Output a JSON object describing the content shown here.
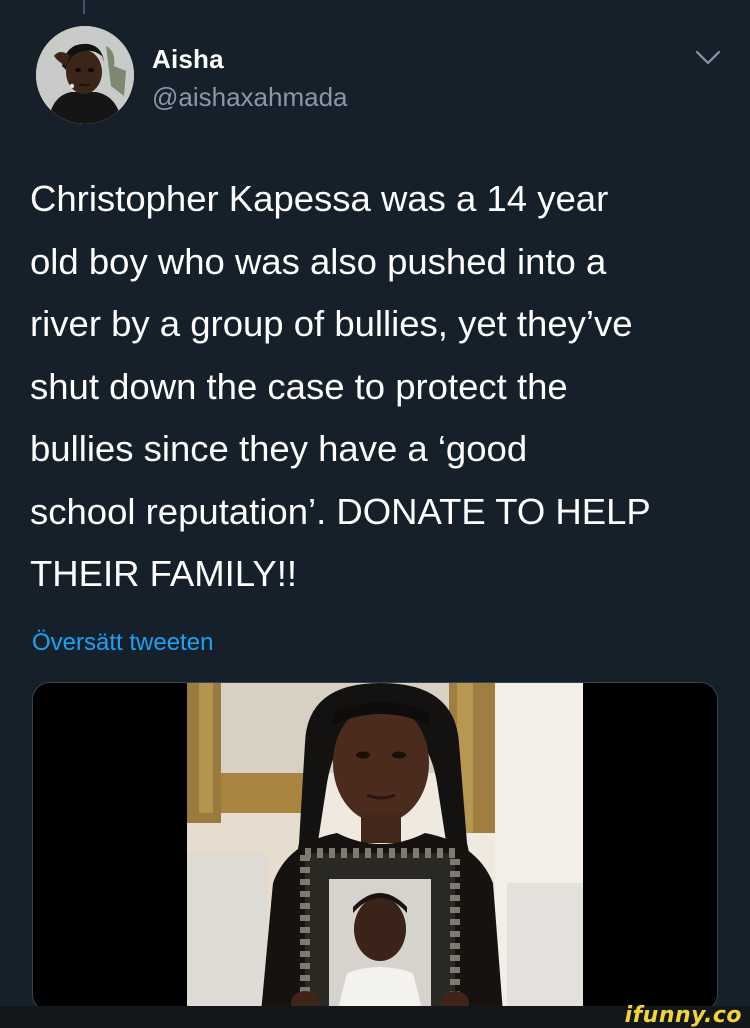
{
  "tweet": {
    "author_name": "Aisha",
    "author_handle": "@aishaxahmada",
    "text_lines": [
      "Christopher Kapessa was a 14 year",
      "old boy who was also pushed into a",
      "river by a group of bullies, yet they’ve",
      "shut down the case to protect the",
      "bullies since they have a ‘good",
      "school reputation’. DONATE TO HELP",
      "THEIR FAMILY!!"
    ],
    "translate_label": "Översätt tweeten"
  },
  "icons": {
    "menu": "chevron-down-icon"
  },
  "watermark": "ifunny.co",
  "colors": {
    "background": "#15202b",
    "text": "#ffffff",
    "secondary_text": "#8899a6",
    "link": "#1da1f2",
    "watermark": "#f2d33a"
  }
}
